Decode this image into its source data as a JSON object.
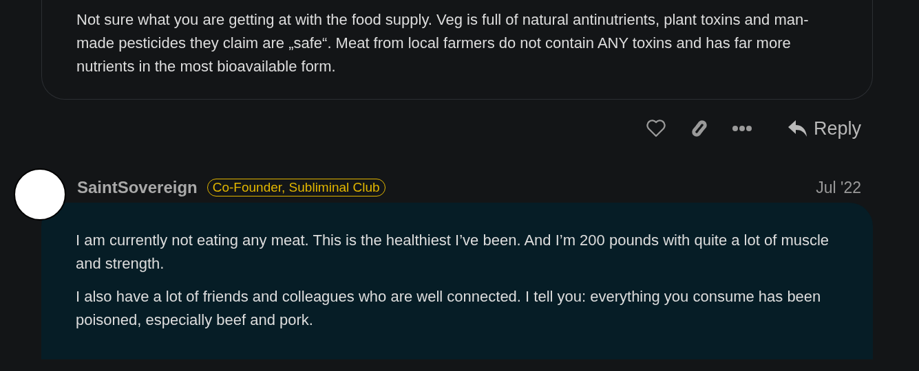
{
  "posts": [
    {
      "paragraphs": [
        "Not sure what you are getting at with the food supply. Veg is full of natural antinutrients, plant toxins and man-made pesticides they claim are „safe“. Meat from local farmers do not contain ANY toxins and has far more nutrients in the most bioavailable form."
      ],
      "actions": {
        "reply_label": "Reply"
      }
    },
    {
      "username": "SaintSovereign",
      "flair": "Co-Founder, Subliminal Club",
      "date": "Jul '22",
      "highlighted": true,
      "paragraphs": [
        "I am currently not eating any meat. This is the healthiest I’ve been. And I’m 200 pounds with quite a lot of muscle and strength.",
        "I also have a lot of friends and colleagues who are well connected. I tell you: everything you consume has been poisoned, especially beef and pork."
      ]
    }
  ]
}
